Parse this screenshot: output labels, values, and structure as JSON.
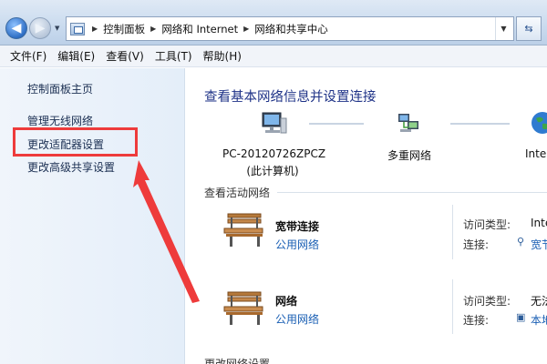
{
  "address_bar": {
    "breadcrumbs": [
      "控制面板",
      "网络和 Internet",
      "网络和共享中心"
    ],
    "icons": [
      "back-icon",
      "forward-icon",
      "control-panel-icon",
      "refresh-icon"
    ]
  },
  "menu": {
    "items": [
      "文件(F)",
      "编辑(E)",
      "查看(V)",
      "工具(T)",
      "帮助(H)"
    ]
  },
  "sidebar": {
    "items": [
      {
        "label": "控制面板主页"
      },
      {
        "label": "管理无线网络"
      },
      {
        "label": "更改适配器设置",
        "highlighted": true
      },
      {
        "label": "更改高级共享设置"
      }
    ],
    "highlight_color": "#ee3b3b"
  },
  "main": {
    "title": "查看基本网络信息并设置连接",
    "network_map": {
      "nodes": [
        {
          "label": "PC-20120726ZPCZ",
          "sublabel": "(此计算机)",
          "icon": "computer-icon"
        },
        {
          "label": "多重网络",
          "icon": "multiple-networks-icon"
        },
        {
          "label": "Inte",
          "icon": "globe-icon"
        }
      ]
    },
    "active_networks_header": "查看活动网络",
    "networks": [
      {
        "name": "宽带连接",
        "type": "公用网络",
        "icon": "bench-icon",
        "access_type_label": "访问类型:",
        "access_type_value": "Inte",
        "connection_label": "连接:",
        "connection_value": "宽节"
      },
      {
        "name": "网络",
        "type": "公用网络",
        "icon": "bench-icon",
        "access_type_label": "访问类型:",
        "access_type_value": "无法",
        "connection_label": "连接:",
        "connection_value": "本地"
      }
    ],
    "change_settings_header": "更改网络设置"
  },
  "colors": {
    "title_blue": "#1e3287",
    "link_blue": "#1a5fb4",
    "annotation_red": "#ee3b3b"
  }
}
